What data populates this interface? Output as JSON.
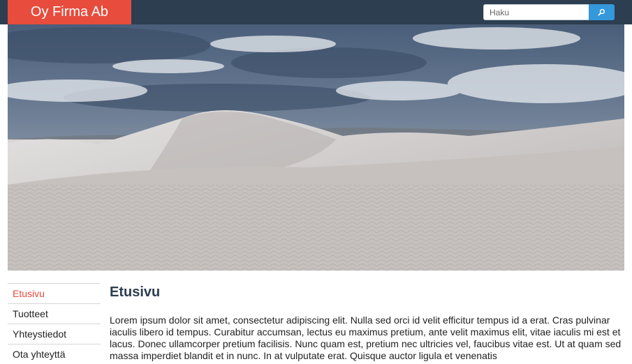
{
  "header": {
    "brand": "Oy Firma Ab",
    "search": {
      "placeholder": "Haku",
      "button_icon": "search-icon"
    },
    "colors": {
      "bar": "#2c3e50",
      "brand": "#e74c3c",
      "button": "#3498db"
    }
  },
  "hero": {
    "image": "desert-sand-dunes"
  },
  "sidebar": {
    "items": [
      {
        "label": "Etusivu",
        "active": true
      },
      {
        "label": "Tuotteet"
      },
      {
        "label": "Yhteystiedot"
      },
      {
        "label": "Ota yhteyttä"
      }
    ]
  },
  "main": {
    "title": "Etusivu",
    "paragraph": "Lorem ipsum dolor sit amet, consectetur adipiscing elit. Nulla sed orci id velit efficitur tempus id a erat. Cras pulvinar iaculis libero id tempus. Curabitur accumsan, lectus eu maximus pretium, ante velit maximus elit, vitae iaculis mi est et lacus. Donec ullamcorper pretium facilisis. Nunc quam est, pretium nec ultricies vel, faucibus vitae est. Ut at quam sed massa imperdiet blandit et in nunc. In at vulputate erat. Quisque auctor ligula et venenatis"
  }
}
